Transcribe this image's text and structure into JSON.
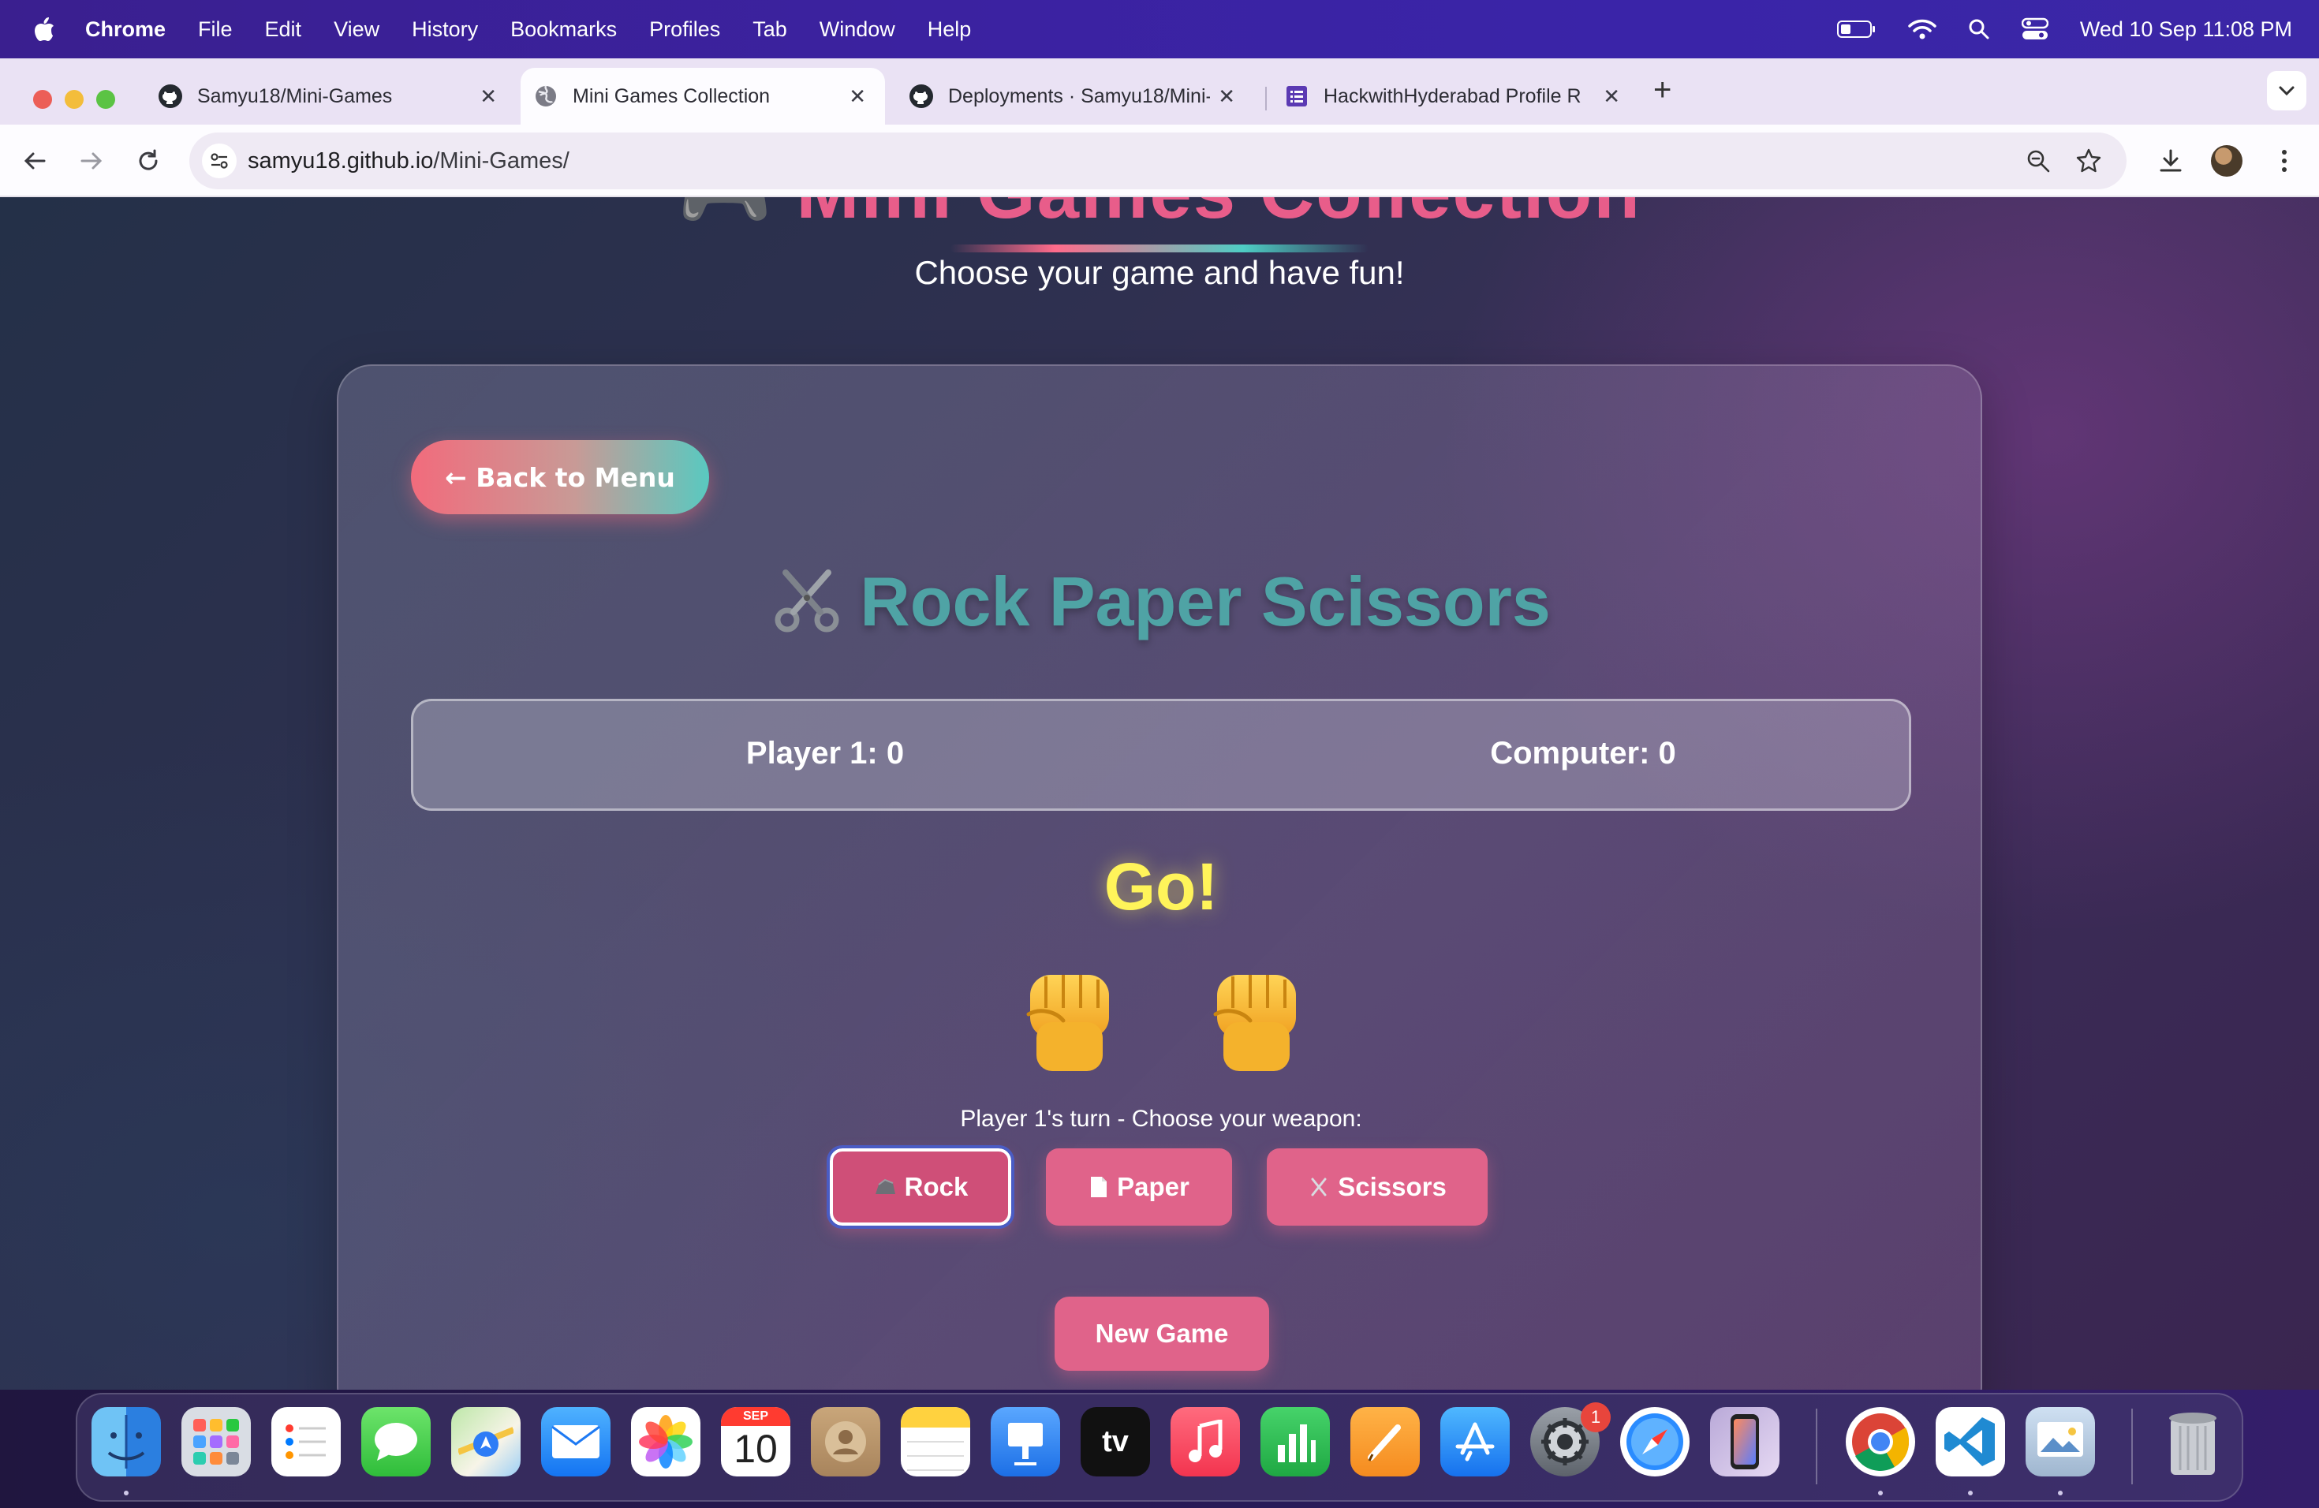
{
  "menubar": {
    "app": "Chrome",
    "items": [
      "File",
      "Edit",
      "View",
      "History",
      "Bookmarks",
      "Profiles",
      "Tab",
      "Window",
      "Help"
    ],
    "clock": "Wed 10 Sep  11:08 PM"
  },
  "tabs": [
    {
      "label": "Samyu18/Mini-Games",
      "icon": "github-icon",
      "active": false
    },
    {
      "label": "Mini Games Collection",
      "icon": "globe-icon",
      "active": true
    },
    {
      "label": "Deployments · Samyu18/Mini-",
      "icon": "github-icon",
      "active": false
    },
    {
      "label": "HackwithHyderabad Profile R",
      "icon": "forms-icon",
      "active": false
    }
  ],
  "toolbar": {
    "url_host": "samyu18.github.io",
    "url_path": "/Mini-Games/"
  },
  "page": {
    "hero_title": "🎮 Mini Games Collection",
    "subtitle": "Choose your game and have fun!",
    "back_button": "← Back to Menu",
    "game_title": "Rock Paper Scissors",
    "scores": {
      "player": "Player 1: 0",
      "computer": "Computer: 0"
    },
    "status": "Go!",
    "turn_text": "Player 1's turn - Choose your weapon:",
    "weapons": [
      {
        "label": "Rock",
        "icon": "rock-icon",
        "selected": true
      },
      {
        "label": "Paper",
        "icon": "paper-icon",
        "selected": false
      },
      {
        "label": "Scissors",
        "icon": "scissors-icon",
        "selected": false
      }
    ],
    "new_game": "New Game"
  },
  "dock": {
    "apps": [
      "Finder",
      "Launchpad",
      "Reminders",
      "Messages",
      "Maps",
      "Mail",
      "Photos",
      "Calendar",
      "Contacts",
      "Notes",
      "Keynote",
      "TV",
      "Music",
      "Numbers",
      "Pages",
      "App Store",
      "System Settings",
      "Safari",
      "iPhone Mirroring",
      "Chrome",
      "Visual Studio Code",
      "Preview",
      "Trash"
    ],
    "calendar_month": "SEP",
    "calendar_day": "10",
    "tv_label": "tv",
    "settings_badge": "1"
  },
  "colors": {
    "accent_pink": "#e0638a",
    "title_teal": "#4fa3a5",
    "status_yellow": "#fff45a",
    "menubar_purple": "#3a22a0"
  }
}
